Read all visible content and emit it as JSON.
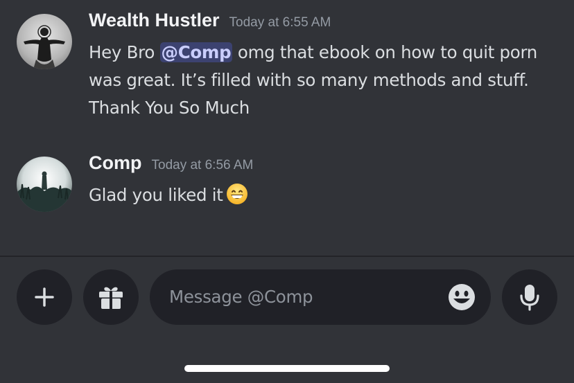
{
  "messages": [
    {
      "username": "Wealth Hustler",
      "timestamp": "Today at 6:55 AM",
      "text_before": "Hey Bro ",
      "mention": "@Comp",
      "text_after": " omg that ebook on how to quit porn was great. It’s filled with so many methods and stuff. Thank You So Much"
    },
    {
      "username": "Comp",
      "timestamp": "Today at 6:56 AM",
      "text": "Glad you liked it",
      "emoji": "grinning-face-with-smiling-eyes"
    }
  ],
  "composer": {
    "placeholder": "Message @Comp",
    "buttons": {
      "add": "plus-icon",
      "gift": "gift-icon",
      "emoji": "emoji-picker-icon",
      "voice": "microphone-icon"
    }
  },
  "colors": {
    "background": "#313338",
    "username": "#f2f3f5",
    "timestamp": "#949ba4",
    "message_text": "#dbdee1",
    "mention_bg": "#3c4270",
    "mention_text": "#c9cdfb",
    "button_bg": "#202127",
    "placeholder": "#8d929a"
  }
}
